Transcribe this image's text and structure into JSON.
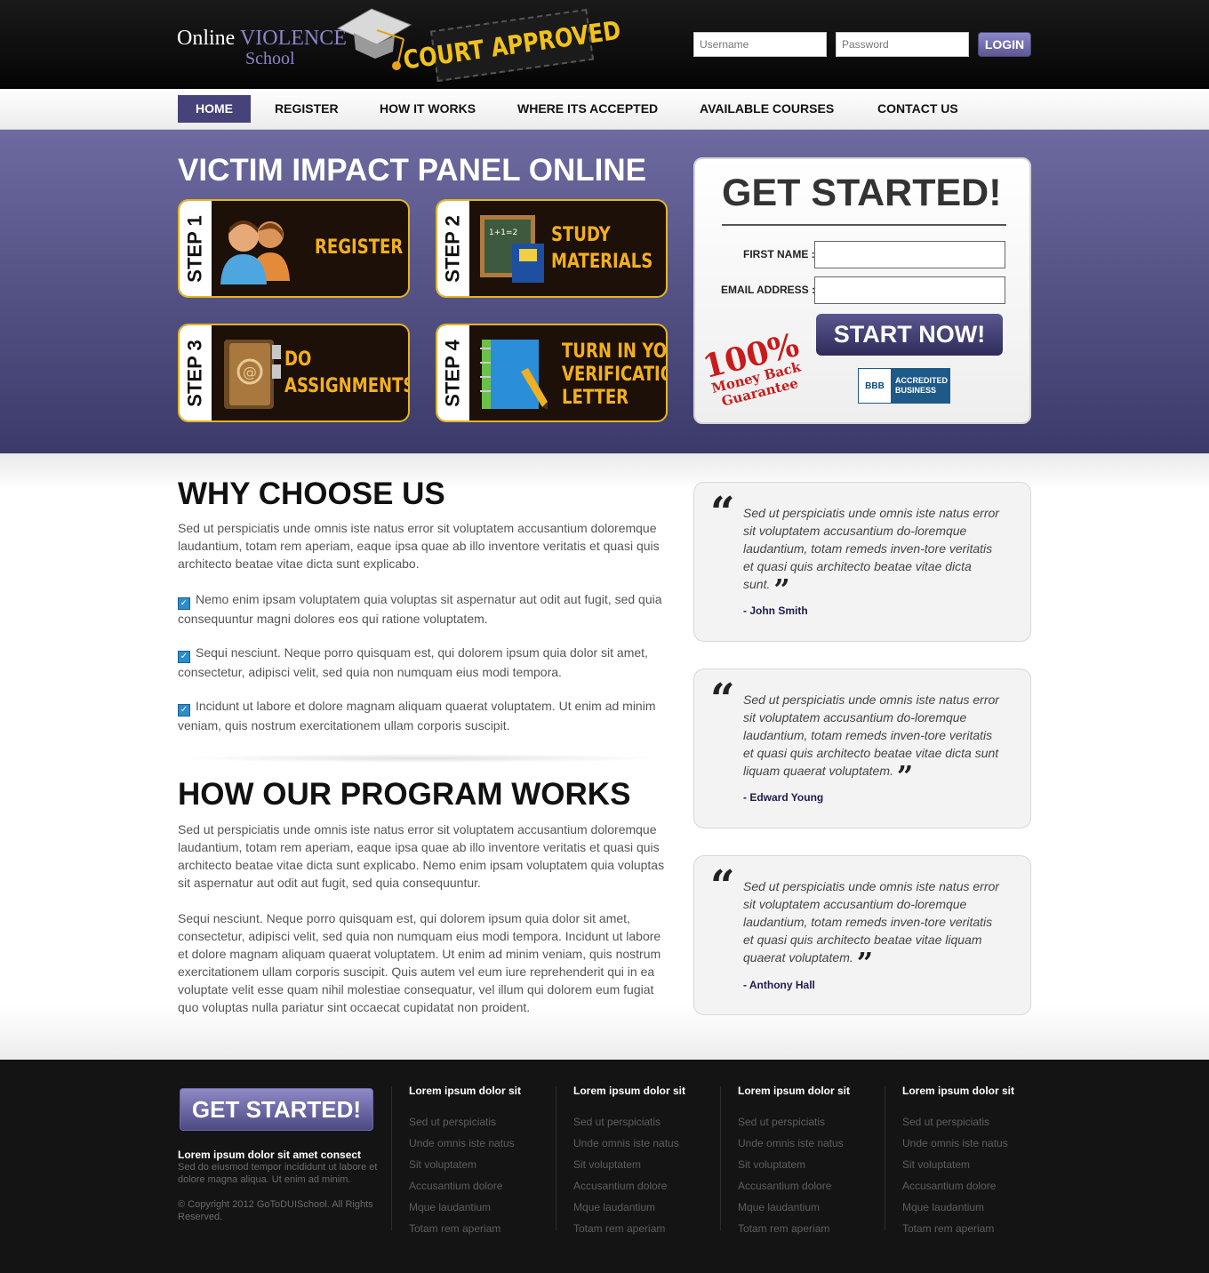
{
  "header": {
    "logo_online": "Online",
    "logo_violence": "VIOLENCE",
    "logo_school": "School",
    "stamp_text": "COURT APPROVED",
    "username_placeholder": "Username",
    "password_placeholder": "Password",
    "login_label": "LOGIN"
  },
  "nav": {
    "items": [
      "HOME",
      "REGISTER",
      "HOW IT WORKS",
      "WHERE ITS ACCEPTED",
      "AVAILABLE COURSES",
      "CONTACT US"
    ]
  },
  "hero": {
    "title": "VICTIM IMPACT PANEL ONLINE",
    "steps": [
      {
        "tab": "STEP 1",
        "line1": "REGISTER",
        "line2": "",
        "line3": ""
      },
      {
        "tab": "STEP 2",
        "line1": "STUDY",
        "line2": "MATERIALS",
        "line3": ""
      },
      {
        "tab": "STEP 3",
        "line1": "DO",
        "line2": "ASSIGNMENTS",
        "line3": ""
      },
      {
        "tab": "STEP 4",
        "line1": "TURN IN YOUR",
        "line2": "VERIFICATION",
        "line3": "LETTER"
      }
    ]
  },
  "signup": {
    "title": "GET STARTED!",
    "first_name_label": "FIRST NAME :",
    "email_label": "EMAIL ADDRESS :",
    "start_label": "START NOW!",
    "guarantee_big": "100%",
    "guarantee_line1": "Money Back",
    "guarantee_line2": "Guarantee",
    "bbb_logo": "BBB",
    "bbb_line1": "ACCREDITED",
    "bbb_line2": "BUSINESS"
  },
  "why": {
    "title": "WHY CHOOSE US",
    "intro": "Sed ut perspiciatis unde omnis iste natus error sit voluptatem accusantium doloremque laudantium, totam rem aperiam, eaque ipsa quae ab illo inventore veritatis et quasi quis architecto beatae vitae dicta sunt explicabo.",
    "bullets": [
      "Nemo enim ipsam voluptatem quia voluptas sit aspernatur aut odit aut fugit, sed quia consequuntur magni dolores eos qui ratione voluptatem.",
      "Sequi nesciunt. Neque porro quisquam est, qui dolorem ipsum quia dolor sit amet, consectetur, adipisci velit, sed quia non numquam eius modi tempora.",
      "Incidunt ut labore et dolore magnam aliquam quaerat voluptatem. Ut enim ad minim veniam, quis nostrum exercitationem ullam corporis suscipit."
    ]
  },
  "program": {
    "title": "HOW OUR PROGRAM WORKS",
    "para1": "Sed ut perspiciatis unde omnis iste natus error sit voluptatem accusantium doloremque laudantium, totam rem aperiam, eaque ipsa quae ab illo inventore veritatis et quasi quis architecto beatae vitae dicta sunt explicabo. Nemo enim ipsam voluptatem quia voluptas sit aspernatur aut odit aut fugit, sed quia consequuntur.",
    "para2": "Sequi nesciunt. Neque porro quisquam est, qui dolorem ipsum quia dolor sit amet, consectetur, adipisci velit, sed quia non numquam eius modi tempora. Incidunt ut labore et dolore magnam aliquam quaerat voluptatem. Ut enim ad minim veniam, quis nostrum exercitationem ullam corporis suscipit. Quis autem vel eum iure reprehenderit qui in ea voluptate velit esse quam nihil molestiae consequatur, vel illum qui dolorem eum fugiat quo voluptas nulla pariatur sint occaecat cupidatat non proident."
  },
  "testimonials": [
    {
      "text": "Sed ut perspiciatis unde omnis iste natus error sit voluptatem accusantium do-loremque laudantium, totam remeds inven-tore veritatis et quasi quis architecto beatae vitae dicta sunt.",
      "author": "- John Smith"
    },
    {
      "text": "Sed ut perspiciatis unde omnis iste natus error sit voluptatem accusantium do-loremque laudantium, totam remeds inven-tore veritatis et quasi quis architecto beatae vitae dicta sunt liquam quaerat voluptatem.",
      "author": "- Edward Young"
    },
    {
      "text": "Sed ut perspiciatis unde omnis iste natus error sit voluptatem accusantium do-loremque laudantium, totam remeds inven-tore veritatis et quasi quis architecto beatae vitae liquam quaerat voluptatem.",
      "author": "- Anthony Hall"
    }
  ],
  "footer": {
    "cta_label": "GET STARTED!",
    "heading": "Lorem ipsum dolor sit amet consect",
    "blurb": "Sed do eiusmod tempor incididunt ut labore et dolore magna aliqua. Ut enim ad minim.",
    "copyright": "© Copyright 2012 GoToDUISchool. All Rights Reserved.",
    "columns": [
      {
        "title": "Lorem ipsum dolor sit",
        "links": [
          "Sed ut perspiciatis",
          "Unde omnis iste natus",
          "Sit voluptatem",
          "Accusantium dolore",
          "Mque laudantium",
          "Totam rem aperiam"
        ]
      },
      {
        "title": "Lorem ipsum dolor sit",
        "links": [
          "Sed ut perspiciatis",
          "Unde omnis iste natus",
          "Sit voluptatem",
          "Accusantium dolore",
          "Mque laudantium",
          "Totam rem aperiam"
        ]
      },
      {
        "title": "Lorem ipsum dolor sit",
        "links": [
          "Sed ut perspiciatis",
          "Unde omnis iste natus",
          "Sit voluptatem",
          "Accusantium dolore",
          "Mque laudantium",
          "Totam rem aperiam"
        ]
      },
      {
        "title": "Lorem ipsum dolor sit",
        "links": [
          "Sed ut perspiciatis",
          "Unde omnis iste natus",
          "Sit voluptatem",
          "Accusantium dolore",
          "Mque laudantium",
          "Totam rem aperiam"
        ]
      }
    ]
  },
  "colors": {
    "brand_purple": "#46437a",
    "step_gold": "#f3b01c",
    "step_border": "#e3b622",
    "stamp_yellow": "#f2c21a",
    "guarantee_red": "#c91b1b"
  },
  "icons": {
    "logo": "graduation-cap-icon",
    "step1": "users-icon",
    "step2": "chalkboard-book-icon",
    "step3": "address-book-icon",
    "step4": "notebook-pencil-icon",
    "check": "checkbox-checked-icon"
  }
}
